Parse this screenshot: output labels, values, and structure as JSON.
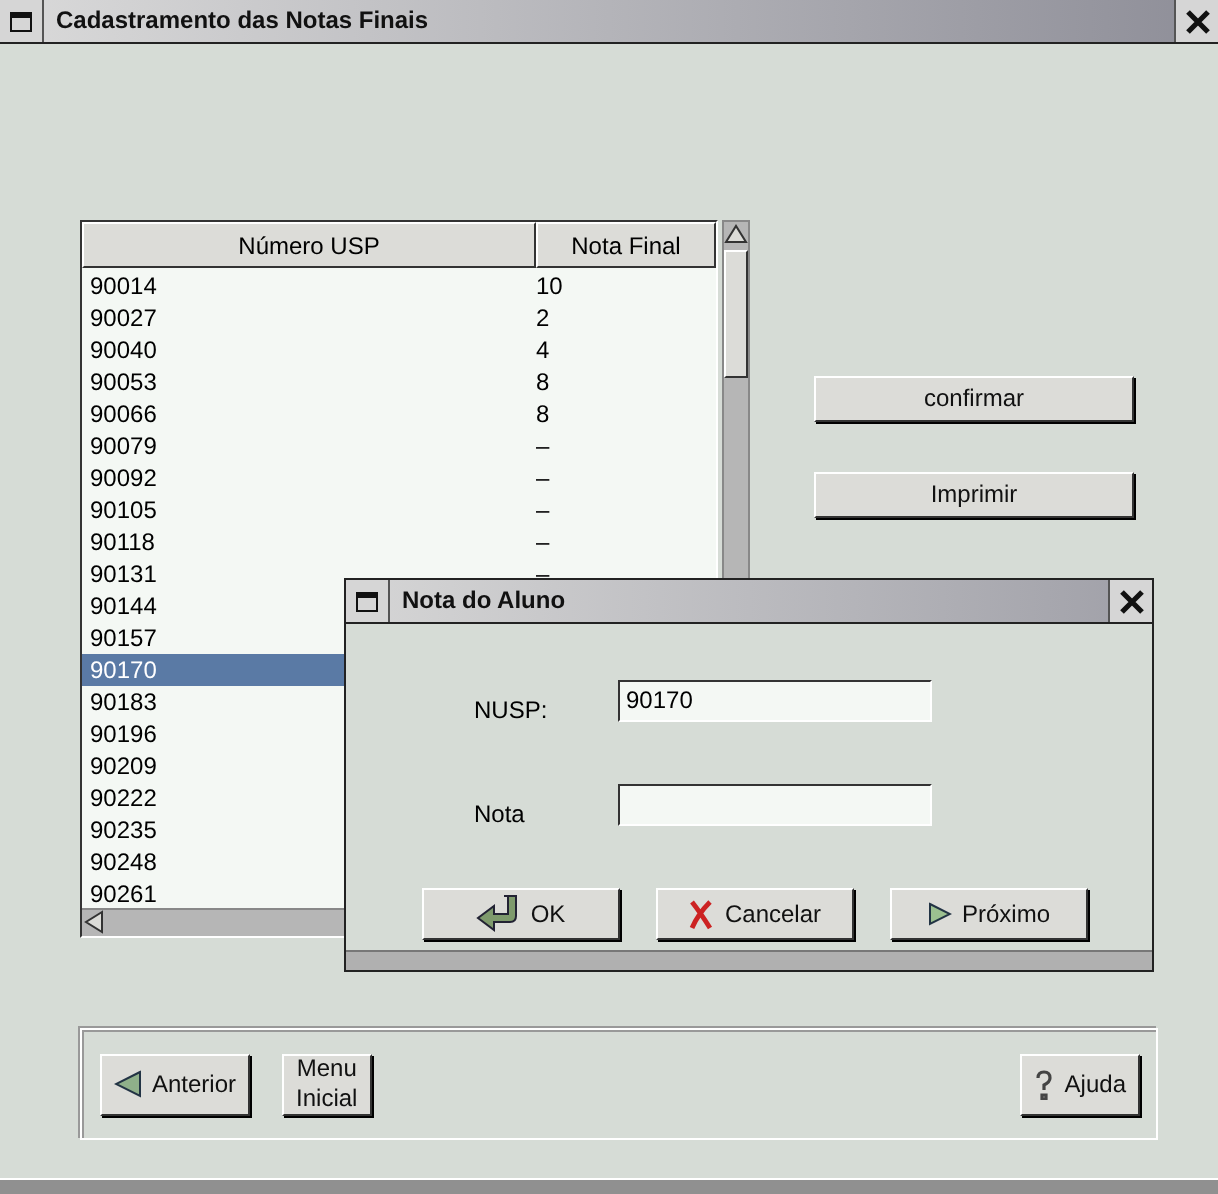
{
  "window": {
    "title": "Cadastramento das Notas Finais"
  },
  "table": {
    "columns": [
      "Número USP",
      "Nota Final"
    ],
    "rows": [
      {
        "numero": "90014",
        "nota": "10",
        "selected": false
      },
      {
        "numero": "90027",
        "nota": "2",
        "selected": false
      },
      {
        "numero": "90040",
        "nota": "4",
        "selected": false
      },
      {
        "numero": "90053",
        "nota": "8",
        "selected": false
      },
      {
        "numero": "90066",
        "nota": "8",
        "selected": false
      },
      {
        "numero": "90079",
        "nota": "–",
        "selected": false
      },
      {
        "numero": "90092",
        "nota": "–",
        "selected": false
      },
      {
        "numero": "90105",
        "nota": "–",
        "selected": false
      },
      {
        "numero": "90118",
        "nota": "–",
        "selected": false
      },
      {
        "numero": "90131",
        "nota": "–",
        "selected": false
      },
      {
        "numero": "90144",
        "selected": false
      },
      {
        "numero": "90157",
        "selected": false
      },
      {
        "numero": "90170",
        "selected": true
      },
      {
        "numero": "90183",
        "selected": false
      },
      {
        "numero": "90196",
        "selected": false
      },
      {
        "numero": "90209",
        "selected": false
      },
      {
        "numero": "90222",
        "selected": false
      },
      {
        "numero": "90235",
        "selected": false
      },
      {
        "numero": "90248",
        "selected": false
      },
      {
        "numero": "90261",
        "selected": false
      }
    ]
  },
  "side_buttons": [
    "confirmar",
    "Imprimir"
  ],
  "bottom_buttons": [
    {
      "label": "Anterior",
      "kind": "back"
    },
    {
      "label": "Menu\nInicial",
      "kind": "plain"
    },
    {
      "label": "Ajuda",
      "kind": "help"
    }
  ],
  "dialog": {
    "title": "Nota do Aluno",
    "fields": [
      {
        "label": "NUSP:",
        "value": "90170"
      },
      {
        "label": "Nota"
      }
    ],
    "buttons": [
      {
        "label": "OK",
        "kind": "ok"
      },
      {
        "label": "Cancelar",
        "kind": "cancel"
      },
      {
        "label": "Próximo",
        "kind": "next"
      }
    ]
  }
}
